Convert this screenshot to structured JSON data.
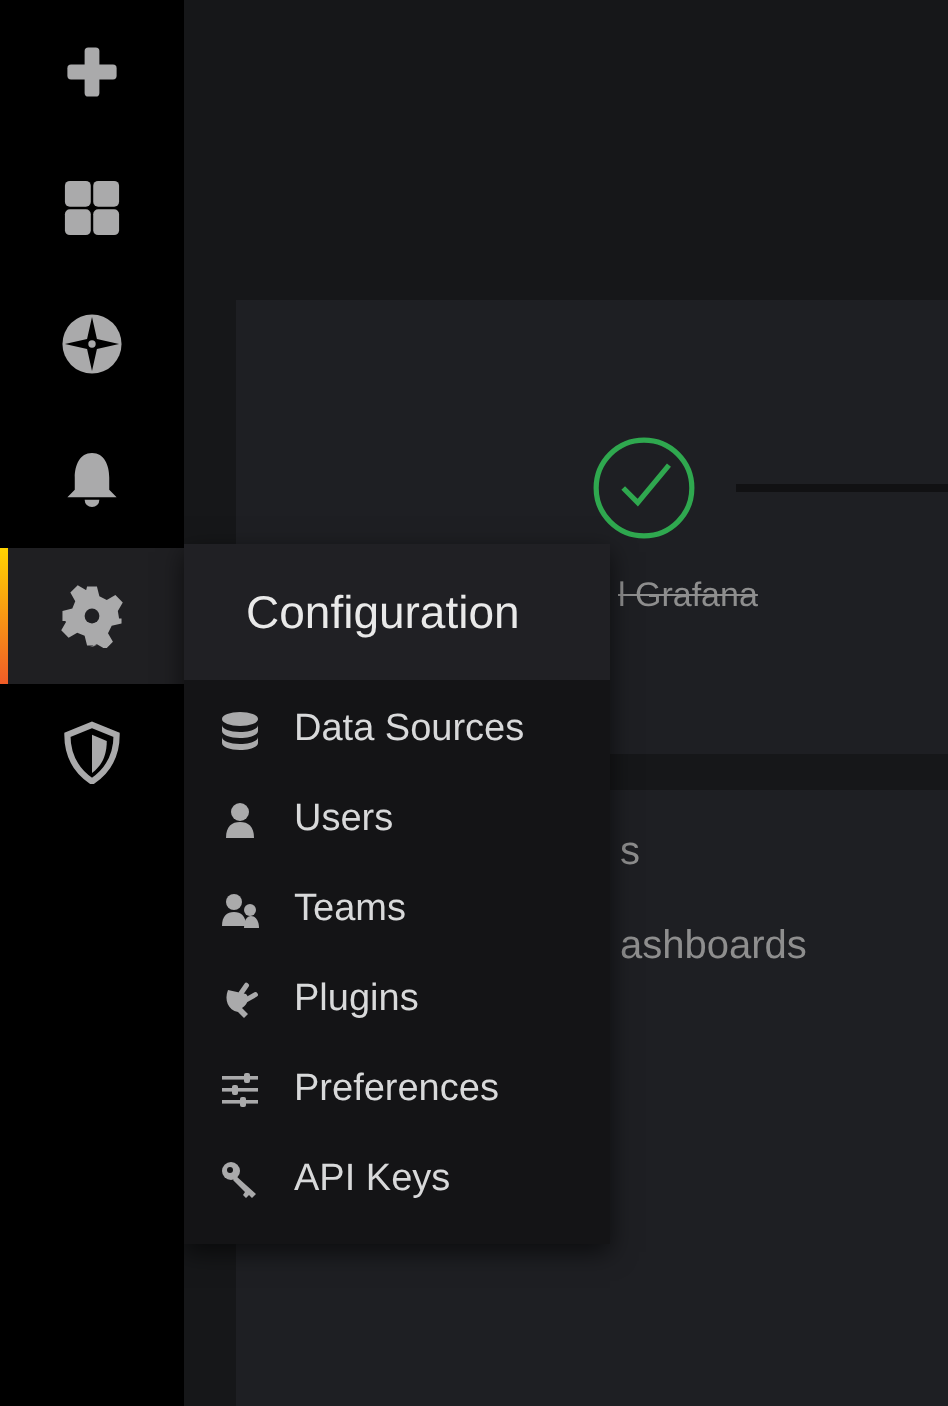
{
  "sidebar": {
    "items": [
      {
        "selected": false
      },
      {
        "selected": false
      },
      {
        "selected": false
      },
      {
        "selected": false
      },
      {
        "selected": true
      },
      {
        "selected": false
      }
    ]
  },
  "getting_started": {
    "step": {
      "label": "l Grafana",
      "done": true
    },
    "lines": [
      "s",
      "ashboards"
    ]
  },
  "menu": {
    "title": "Configuration",
    "items": [
      {
        "label": "Data Sources"
      },
      {
        "label": "Users"
      },
      {
        "label": "Teams"
      },
      {
        "label": "Plugins"
      },
      {
        "label": "Preferences"
      },
      {
        "label": "API Keys"
      }
    ]
  }
}
